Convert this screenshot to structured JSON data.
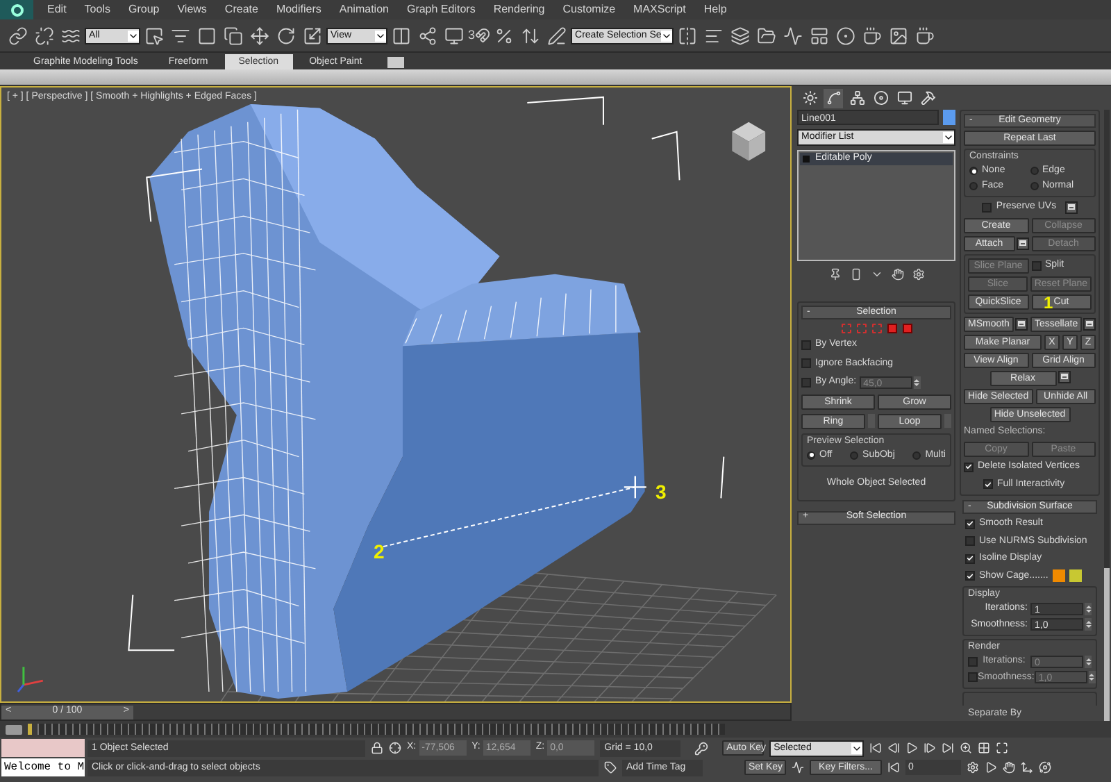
{
  "menu": [
    "Edit",
    "Tools",
    "Group",
    "Views",
    "Create",
    "Modifiers",
    "Animation",
    "Graph Editors",
    "Rendering",
    "Customize",
    "MAXScript",
    "Help"
  ],
  "toolbar": {
    "selection_filter": "All",
    "reference_coordinate": "View",
    "snap_mode": "3",
    "named_selection": "Create Selection Se"
  },
  "ribbon": {
    "tabs": [
      {
        "label": "Graphite Modeling Tools",
        "selected": false
      },
      {
        "label": "Freeform",
        "selected": false
      },
      {
        "label": "Selection",
        "selected": true
      },
      {
        "label": "Object Paint",
        "selected": false
      }
    ]
  },
  "viewport": {
    "label": "[ + ] [ Perspective ] [ Smooth + Highlights + Edged Faces ]",
    "annotations": [
      {
        "text": "2"
      },
      {
        "text": "3"
      }
    ],
    "time_slider": {
      "prev": "<",
      "position": "0 / 100",
      "next": ">"
    }
  },
  "command_panel": {
    "object_name": "Line001",
    "color": "#5b9bef",
    "modifier_list": "Modifier List",
    "stack": [
      {
        "label": "Editable Poly",
        "selected": true
      }
    ]
  },
  "selection": {
    "title": "Selection",
    "collapse": "-",
    "options": [
      {
        "label": "By Vertex",
        "checked": false
      },
      {
        "label": "Ignore Backfacing",
        "checked": false
      }
    ],
    "by_angle": {
      "label": "By Angle:",
      "checked": false,
      "value": "45,0"
    },
    "shrink": "Shrink",
    "grow": "Grow",
    "ring": "Ring",
    "loop": "Loop",
    "preview": {
      "title": "Preview Selection",
      "options": [
        {
          "label": "Off",
          "selected": true
        },
        {
          "label": "SubObj",
          "selected": false
        },
        {
          "label": "Multi",
          "selected": false
        }
      ]
    },
    "status": "Whole Object Selected"
  },
  "soft_selection": {
    "title": "Soft Selection",
    "expand": "+"
  },
  "edit_geometry": {
    "title": "Edit Geometry",
    "collapse": "-",
    "repeat_last": "Repeat Last",
    "constraints": {
      "title": "Constraints",
      "options": [
        {
          "label": "None",
          "selected": true
        },
        {
          "label": "Edge",
          "selected": false
        },
        {
          "label": "Face",
          "selected": false
        },
        {
          "label": "Normal",
          "selected": false
        }
      ]
    },
    "preserve_uvs": {
      "label": "Preserve UVs",
      "checked": false
    },
    "rows": [
      [
        {
          "kind": "button",
          "label": "Create",
          "disabled": false
        },
        {
          "kind": "button",
          "label": "Collapse",
          "disabled": true
        }
      ],
      [
        {
          "kind": "button",
          "label": "Attach",
          "disabled": false,
          "settings": true
        },
        {
          "kind": "button",
          "label": "Detach",
          "disabled": true
        }
      ]
    ],
    "slice_rows": [
      [
        {
          "kind": "button",
          "label": "Slice Plane",
          "disabled": true
        },
        {
          "kind": "checkbox",
          "label": "Split",
          "checked": false
        }
      ],
      [
        {
          "kind": "button",
          "label": "Slice",
          "disabled": true
        },
        {
          "kind": "button",
          "label": "Reset Plane",
          "disabled": true
        }
      ],
      [
        {
          "kind": "button",
          "label": "QuickSlice",
          "disabled": false
        },
        {
          "kind": "button",
          "label": "Cut",
          "disabled": false,
          "annotation": "1"
        }
      ]
    ],
    "more_rows": [
      [
        {
          "kind": "button",
          "label": "MSmooth",
          "disabled": false,
          "settings": true
        },
        {
          "kind": "button",
          "label": "Tessellate",
          "disabled": false,
          "settings": true
        }
      ],
      [
        {
          "kind": "button",
          "label": "Make Planar",
          "disabled": false
        },
        {
          "kind": "small",
          "label": "X",
          "disabled": false
        },
        {
          "kind": "small",
          "label": "Y",
          "disabled": false
        },
        {
          "kind": "small",
          "label": "Z",
          "disabled": false
        }
      ],
      [
        {
          "kind": "button",
          "label": "View Align",
          "disabled": false
        },
        {
          "kind": "button",
          "label": "Grid Align",
          "disabled": false
        }
      ],
      [
        {
          "kind": "center",
          "label": "Relax",
          "disabled": false,
          "settings": true
        }
      ],
      [
        {
          "kind": "button",
          "label": "Hide Selected",
          "disabled": false
        },
        {
          "kind": "button",
          "label": "Unhide All",
          "disabled": false
        }
      ],
      [
        {
          "kind": "center",
          "label": "Hide Unselected",
          "disabled": false
        }
      ]
    ],
    "named_selections": {
      "title": "Named Selections:",
      "copy": {
        "label": "Copy",
        "disabled": true
      },
      "paste": {
        "label": "Paste",
        "disabled": true
      }
    },
    "delete_isolated": {
      "label": "Delete Isolated Vertices",
      "checked": true
    },
    "full_interactivity": {
      "label": "Full Interactivity",
      "checked": true
    }
  },
  "subdivision": {
    "title": "Subdivision Surface",
    "collapse": "-",
    "options": [
      {
        "label": "Smooth Result",
        "checked": true
      },
      {
        "label": "Use NURMS Subdivision",
        "checked": false
      },
      {
        "label": "Isoline Display",
        "checked": true
      },
      {
        "label": "Show Cage.......",
        "checked": true
      }
    ],
    "cage_colors": [
      {
        "color": "#f08a00"
      },
      {
        "color": "#c8c832"
      }
    ],
    "display": {
      "title": "Display",
      "iterations": {
        "label": "Iterations:",
        "value": "1"
      },
      "smoothness": {
        "label": "Smoothness:",
        "value": "1,0"
      }
    },
    "render": {
      "title": "Render",
      "iterations": {
        "label": "Iterations:",
        "value": "0",
        "checked": false
      },
      "smoothness": {
        "label": "Smoothness:",
        "value": "1,0",
        "checked": false
      }
    },
    "separate_by": {
      "title": "Separate By"
    }
  },
  "status": {
    "listener": "Welcome to M",
    "selection_count": "1 Object Selected",
    "x": {
      "label": "X:",
      "value": "-77,506"
    },
    "y": {
      "label": "Y:",
      "value": "12,654"
    },
    "z": {
      "label": "Z:",
      "value": "0,0"
    },
    "grid": "Grid = 10,0",
    "auto_key": "Auto Key",
    "key_mode": "Selected",
    "set_key": "Set Key",
    "key_filters": "Key Filters...",
    "frame": "0",
    "prompt": "Click or click-and-drag to select objects",
    "add_time_tag": "Add Time Tag"
  }
}
